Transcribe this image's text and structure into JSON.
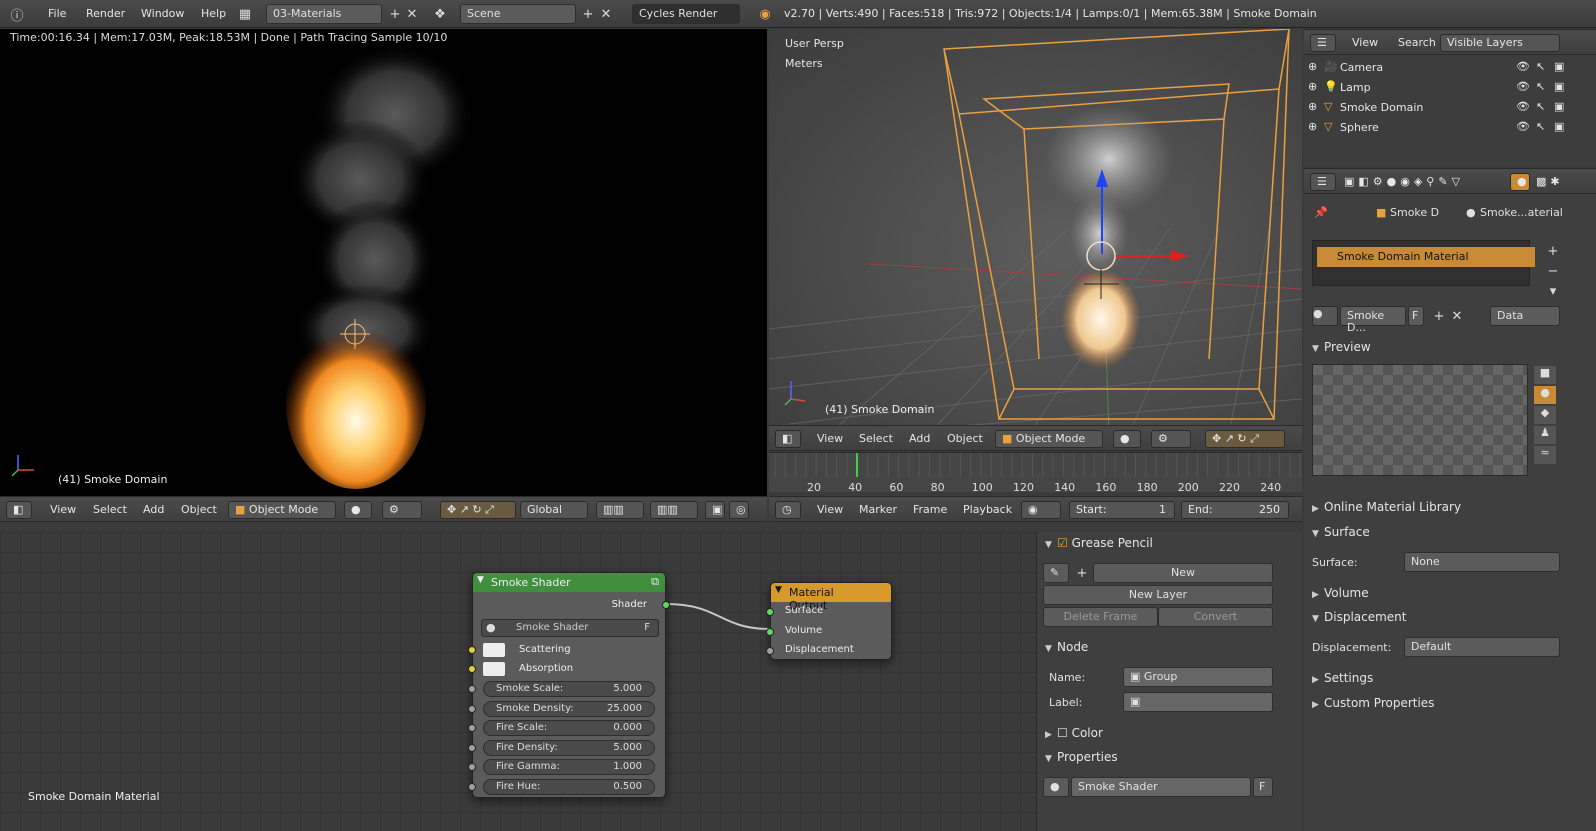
{
  "topbar": {
    "menu": [
      "File",
      "Render",
      "Window",
      "Help"
    ],
    "layout_name": "03-Materials",
    "scene_name": "Scene",
    "engine": "Cycles Render",
    "stats": "v2.70 | Verts:490 | Faces:518 | Tris:972 | Objects:1/4 | Lamps:0/1 | Mem:65.38M | Smoke Domain"
  },
  "render_view": {
    "status": "Time:00:16.34 | Mem:17.03M, Peak:18.53M | Done | Path Tracing Sample 10/10",
    "object_label": "(41) Smoke Domain"
  },
  "viewport3d": {
    "view_name": "User Persp",
    "units": "Meters",
    "object_label": "(41) Smoke Domain"
  },
  "viewport_header": {
    "items": [
      "View",
      "Select",
      "Add",
      "Object"
    ],
    "mode": "Object Mode"
  },
  "timeline": {
    "ticks": [
      "20",
      "40",
      "60",
      "80",
      "100",
      "120",
      "140",
      "160",
      "180",
      "200",
      "220",
      "240"
    ],
    "current_frame": 41
  },
  "left_header": {
    "items": [
      "View",
      "Select",
      "Add",
      "Object"
    ],
    "mode": "Object Mode",
    "orientation": "Global"
  },
  "timeline_header": {
    "items": [
      "View",
      "Marker",
      "Frame",
      "Playback"
    ],
    "start_label": "Start:",
    "start_value": "1",
    "end_label": "End:",
    "end_value": "250"
  },
  "outliner": {
    "header_items": [
      "View",
      "Search"
    ],
    "filter": "Visible Layers",
    "items": [
      {
        "name": "Camera"
      },
      {
        "name": "Lamp"
      },
      {
        "name": "Smoke Domain"
      },
      {
        "name": "Sphere"
      }
    ]
  },
  "properties": {
    "breadcrumb_object": "Smoke D",
    "breadcrumb_material": "Smoke...aterial",
    "material_slot": "Smoke Domain Material",
    "material_field": "Smoke D...",
    "material_fake": "F",
    "link": "Data",
    "sections": {
      "preview": "Preview",
      "online": "Online Material Library",
      "surface": "Surface",
      "volume": "Volume",
      "displacement": "Displacement",
      "settings": "Settings",
      "custom": "Custom Properties"
    },
    "surface_label": "Surface:",
    "surface_value": "None",
    "displacement_label": "Displacement:",
    "displacement_value": "Default"
  },
  "node_editor": {
    "material_name": "Smoke Domain Material",
    "smoke_node": {
      "title": "Smoke Shader",
      "output": "Shader",
      "group_name": "Smoke Shader",
      "group_fake": "F",
      "color_inputs": [
        "Scattering",
        "Absorption"
      ],
      "fields": [
        {
          "label": "Smoke Scale:",
          "value": "5.000"
        },
        {
          "label": "Smoke Density:",
          "value": "25.000"
        },
        {
          "label": "Fire Scale:",
          "value": "0.000"
        },
        {
          "label": "Fire Density:",
          "value": "5.000"
        },
        {
          "label": "Fire Gamma:",
          "value": "1.000"
        },
        {
          "label": "Fire Hue:",
          "value": "0.500"
        }
      ]
    },
    "output_node": {
      "title": "Material Output",
      "inputs": [
        "Surface",
        "Volume",
        "Displacement"
      ]
    }
  },
  "npanel": {
    "grease_pencil": "Grease Pencil",
    "new": "New",
    "new_layer": "New Layer",
    "delete_frame": "Delete Frame",
    "convert": "Convert",
    "node_section": "Node",
    "name_label": "Name:",
    "name_value": "Group",
    "label_label": "Label:",
    "label_value": "",
    "color_section": "Color",
    "properties_section": "Properties",
    "group_value": "Smoke Shader",
    "group_fake": "F"
  },
  "colors": {
    "smoke_header": "#3f8f3f",
    "output_header": "#d79a2a",
    "material_slot": "#c98a35",
    "selection_orange": "#e8a040"
  }
}
